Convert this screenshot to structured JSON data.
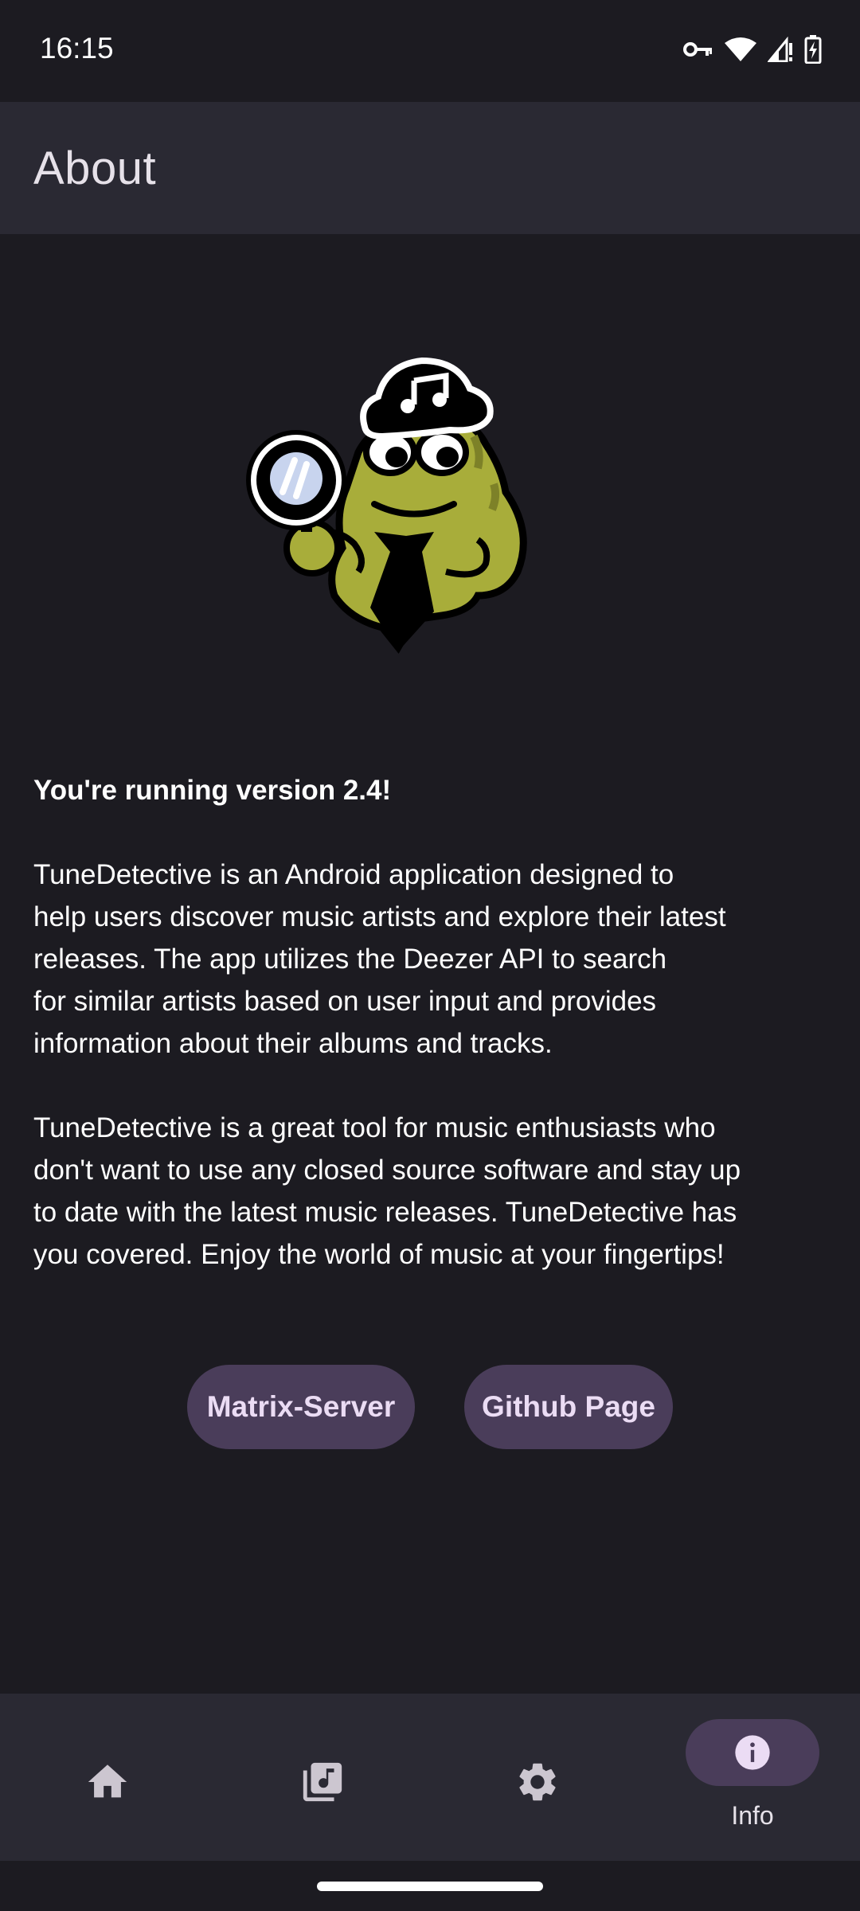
{
  "status_bar": {
    "time": "16:15",
    "icons": [
      "vpn-key-icon",
      "wifi-icon",
      "signal-icon",
      "battery-charging-icon"
    ]
  },
  "app_bar": {
    "title": "About"
  },
  "logo": {
    "description_icon": "detective-frog-icon"
  },
  "content": {
    "version_text": "You're running version 2.4!",
    "paragraph_1": "TuneDetective is an Android application designed to\nhelp users discover music artists and explore their latest\nreleases. The app utilizes the Deezer API to search\nfor similar artists based on user input and provides\ninformation about their albums and tracks.",
    "paragraph_2": "TuneDetective is a great tool for music enthusiasts who\ndon't want to use any closed source software and stay up\nto date with the latest music releases. TuneDetective has\nyou covered. Enjoy the world of music at your fingertips!"
  },
  "buttons": {
    "matrix_label": "Matrix-Server",
    "github_label": "Github Page"
  },
  "bottom_nav": {
    "items": [
      {
        "icon": "home-icon",
        "label": "",
        "selected": false
      },
      {
        "icon": "library-music-icon",
        "label": "",
        "selected": false
      },
      {
        "icon": "gear-icon",
        "label": "",
        "selected": false
      },
      {
        "icon": "info-icon",
        "label": "Info",
        "selected": true
      }
    ]
  },
  "colors": {
    "background": "#1c1b21",
    "surface": "#2a2933",
    "accent_container": "#4a3d5a",
    "frog_green": "#a8ad3a"
  }
}
